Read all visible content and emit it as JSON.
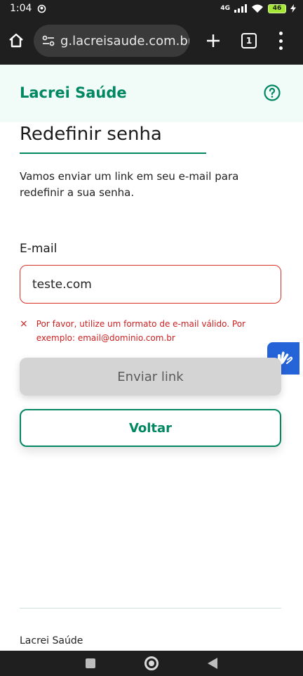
{
  "status_bar": {
    "time": "1:04",
    "network": "4G",
    "battery": "46"
  },
  "browser": {
    "url": "g.lacreisaude.com.br",
    "tab_count": "1"
  },
  "header": {
    "brand": "Lacrei Saúde"
  },
  "page": {
    "title": "Redefinir senha",
    "description": "Vamos enviar um link em seu e-mail para redefinir a sua senha."
  },
  "form": {
    "email_label": "E-mail",
    "email_value": "teste.com",
    "error_icon": "×",
    "error_message": "Por favor, utilize um formato de e-mail válido. Por exemplo: email@dominio.com.br",
    "send_label": "Enviar link",
    "back_label": "Voltar"
  },
  "footer": {
    "text": "Lacrei Saúde"
  },
  "colors": {
    "brand": "#018762",
    "error": "#d93025",
    "accessibility": "#2563d9"
  }
}
